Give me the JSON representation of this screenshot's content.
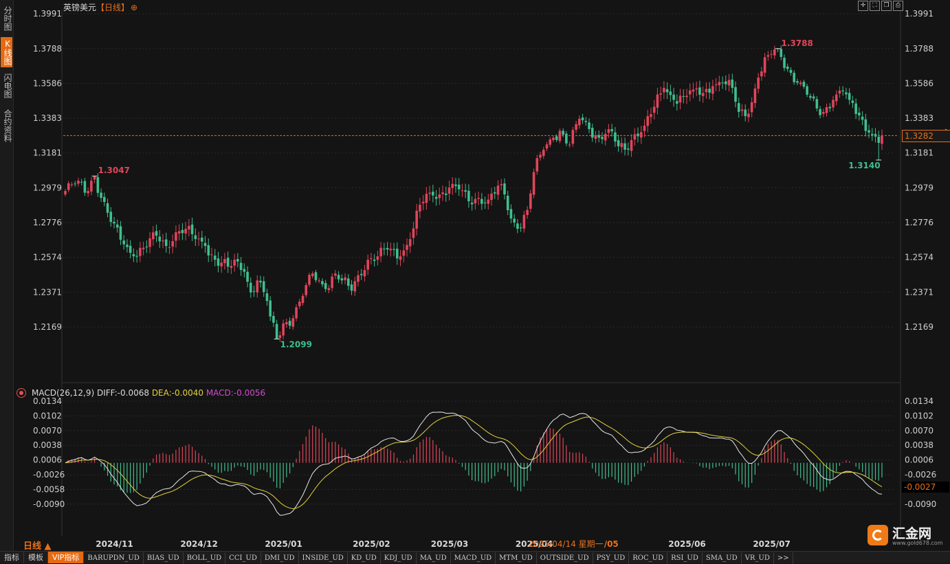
{
  "left_tabs": [
    {
      "label": "分时图",
      "active": false
    },
    {
      "label": "K线图",
      "active": true
    },
    {
      "label": "闪电图",
      "active": false
    },
    {
      "label": "合约资料",
      "active": false
    }
  ],
  "header": {
    "symbol": "英镑美元",
    "period": "【日线】",
    "locate_icon": "crosshair-icon"
  },
  "window_controls": [
    "crosshair-icon",
    "fullscreen-icon",
    "restore-icon",
    "print-icon"
  ],
  "current_price_label": "1.3282",
  "current_macd_label": "-0.0027",
  "date_hint": "2025/04/14 星期一",
  "macd_legend": {
    "name": "MACD(26,12,9)",
    "diff": "DIFF:-0.0068",
    "dea": "DEA:-0.0040",
    "macd": "MACD:-0.0056"
  },
  "period_label": "日线 ▲",
  "bottom_tabs": [
    {
      "label": "指标",
      "active": false,
      "cn": true
    },
    {
      "label": "模板",
      "active": false,
      "cn": true
    },
    {
      "label": "VIP指标",
      "active": true,
      "cn": true
    },
    {
      "label": "BARUPDN_UD",
      "active": false
    },
    {
      "label": "BIAS_UD",
      "active": false
    },
    {
      "label": "BOLL_UD",
      "active": false
    },
    {
      "label": "CCI_UD",
      "active": false
    },
    {
      "label": "DMI_UD",
      "active": false
    },
    {
      "label": "INSIDE_UD",
      "active": false
    },
    {
      "label": "KD_UD",
      "active": false
    },
    {
      "label": "KDJ_UD",
      "active": false
    },
    {
      "label": "MA_UD",
      "active": false
    },
    {
      "label": "MACD_UD",
      "active": false
    },
    {
      "label": "MTM_UD",
      "active": false
    },
    {
      "label": "OUTSIDE_UD",
      "active": false
    },
    {
      "label": "PSY_UD",
      "active": false
    },
    {
      "label": "ROC_UD",
      "active": false
    },
    {
      "label": "RSI_UD",
      "active": false
    },
    {
      "label": "SMA_UD",
      "active": false
    },
    {
      "label": "VR_UD",
      "active": false
    },
    {
      "label": ">>",
      "active": false
    }
  ],
  "logo": {
    "text": "汇金网",
    "url": "www.gold678.com"
  },
  "colors": {
    "up": "#e0455a",
    "down": "#3fbf8f",
    "accent": "#e8701a",
    "diff": "#e8e8e8",
    "dea": "#e4d23c",
    "background": "#141414"
  },
  "chart_data": {
    "type": "candlestick",
    "symbol": "英镑美元",
    "period": "日线",
    "x_labels": [
      "2024/11",
      "2024/12",
      "2025/01",
      "2025/02",
      "2025/03",
      "2025/04",
      "/05",
      "2025/06",
      "2025/07"
    ],
    "price_ticks": [
      "1.3991",
      "1.3788",
      "1.3586",
      "1.3383",
      "1.3181",
      "1.2979",
      "1.2776",
      "1.2574",
      "1.2371",
      "1.2169"
    ],
    "ylim": [
      1.2045,
      1.3991
    ],
    "current_price": 1.3282,
    "annotations": [
      {
        "text": "1.3047",
        "value": 1.3047,
        "type": "high"
      },
      {
        "text": "1.2099",
        "value": 1.2099,
        "type": "low"
      },
      {
        "text": "1.3788",
        "value": 1.3788,
        "type": "high"
      },
      {
        "text": "1.3140",
        "value": 1.314,
        "type": "low"
      }
    ],
    "anchors": [
      [
        0,
        1.296
      ],
      [
        4,
        1.302
      ],
      [
        6,
        1.295
      ],
      [
        9,
        1.3047
      ],
      [
        11,
        1.292
      ],
      [
        14,
        1.278
      ],
      [
        18,
        1.265
      ],
      [
        21,
        1.258
      ],
      [
        24,
        1.263
      ],
      [
        28,
        1.27
      ],
      [
        31,
        1.264
      ],
      [
        34,
        1.272
      ],
      [
        37,
        1.274
      ],
      [
        40,
        1.268
      ],
      [
        43,
        1.264
      ],
      [
        46,
        1.256
      ],
      [
        50,
        1.252
      ],
      [
        53,
        1.255
      ],
      [
        55,
        1.249
      ],
      [
        57,
        1.237
      ],
      [
        59,
        1.244
      ],
      [
        62,
        1.232
      ],
      [
        63,
        1.223
      ],
      [
        65,
        1.2099
      ],
      [
        67,
        1.219
      ],
      [
        70,
        1.222
      ],
      [
        73,
        1.235
      ],
      [
        76,
        1.248
      ],
      [
        78,
        1.244
      ],
      [
        80,
        1.239
      ],
      [
        83,
        1.248
      ],
      [
        85,
        1.244
      ],
      [
        88,
        1.238
      ],
      [
        90,
        1.247
      ],
      [
        93,
        1.256
      ],
      [
        96,
        1.258
      ],
      [
        99,
        1.262
      ],
      [
        103,
        1.258
      ],
      [
        106,
        1.268
      ],
      [
        109,
        1.288
      ],
      [
        112,
        1.295
      ],
      [
        115,
        1.294
      ],
      [
        118,
        1.298
      ],
      [
        121,
        1.297
      ],
      [
        124,
        1.29
      ],
      [
        127,
        1.292
      ],
      [
        130,
        1.291
      ],
      [
        134,
        1.3
      ],
      [
        137,
        1.28
      ],
      [
        139,
        1.274
      ],
      [
        142,
        1.285
      ],
      [
        144,
        1.307
      ],
      [
        147,
        1.32
      ],
      [
        150,
        1.327
      ],
      [
        152,
        1.331
      ],
      [
        155,
        1.323
      ],
      [
        158,
        1.338
      ],
      [
        161,
        1.332
      ],
      [
        164,
        1.327
      ],
      [
        167,
        1.332
      ],
      [
        170,
        1.322
      ],
      [
        172,
        1.32
      ],
      [
        175,
        1.329
      ],
      [
        178,
        1.334
      ],
      [
        181,
        1.345
      ],
      [
        184,
        1.356
      ],
      [
        187,
        1.349
      ],
      [
        190,
        1.351
      ],
      [
        193,
        1.355
      ],
      [
        196,
        1.353
      ],
      [
        199,
        1.357
      ],
      [
        202,
        1.359
      ],
      [
        205,
        1.356
      ],
      [
        207,
        1.342
      ],
      [
        210,
        1.341
      ],
      [
        213,
        1.362
      ],
      [
        216,
        1.375
      ],
      [
        219,
        1.3788
      ],
      [
        222,
        1.367
      ],
      [
        225,
        1.359
      ],
      [
        228,
        1.352
      ],
      [
        231,
        1.344
      ],
      [
        233,
        1.342
      ],
      [
        236,
        1.349
      ],
      [
        239,
        1.354
      ],
      [
        241,
        1.349
      ],
      [
        244,
        1.34
      ],
      [
        247,
        1.33
      ],
      [
        250,
        1.324
      ],
      [
        251,
        1.3282
      ]
    ],
    "n_candles": 252,
    "macd": {
      "name": "MACD(26,12,9)",
      "diff": -0.0068,
      "dea": -0.004,
      "macd": -0.0056,
      "ticks": [
        "0.0134",
        "0.0102",
        "0.0070",
        "0.0038",
        "0.0006",
        "-0.0026",
        "-0.0058",
        "-0.0090"
      ],
      "ylim": [
        -0.0126,
        0.0134
      ]
    }
  }
}
